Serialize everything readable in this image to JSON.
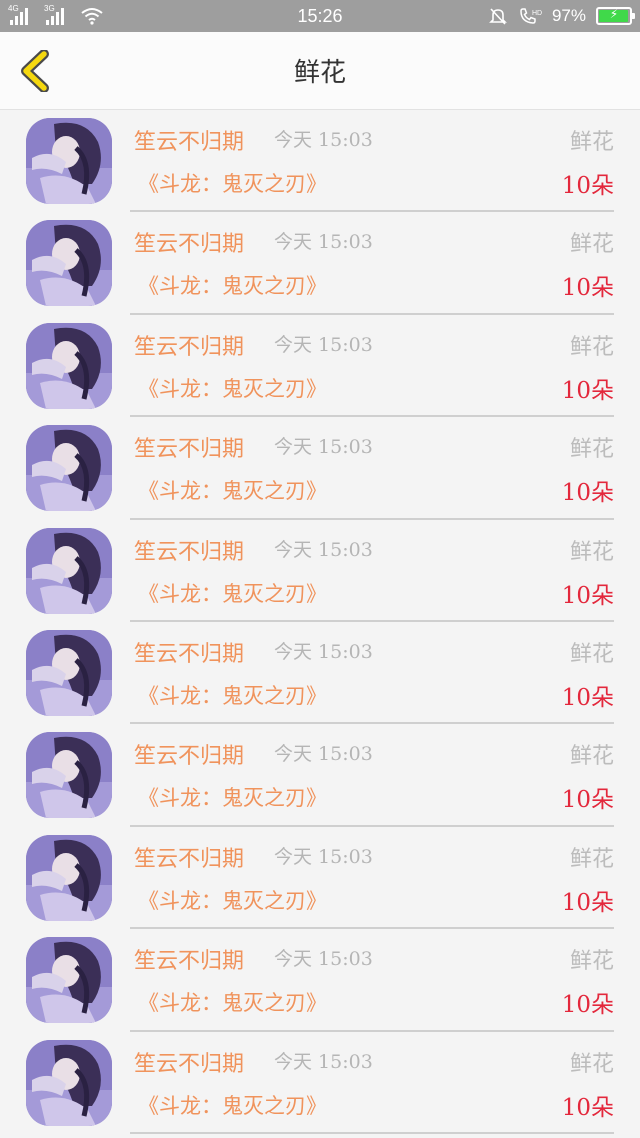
{
  "status_bar": {
    "net_label_1": "4G",
    "net_label_2": "3G",
    "time": "15:26",
    "battery_text": "97%",
    "battery_level": 0.97,
    "icons": [
      "signal-icon",
      "signal-icon",
      "wifi-icon",
      "mute-bell-icon",
      "hd-call-icon",
      "battery-icon"
    ]
  },
  "header": {
    "title": "鲜花",
    "back_icon": "chevron-left-icon",
    "accent_color": "#f5d80f"
  },
  "colors": {
    "name": "#f0935c",
    "count": "#e3283c",
    "muted": "#b5b5b5"
  },
  "records": [
    {
      "name": "笙云不归期",
      "time": "今天 15:03",
      "gift": "鲜花",
      "book": "《斗龙：鬼灭之刃》",
      "count": "10朵"
    },
    {
      "name": "笙云不归期",
      "time": "今天 15:03",
      "gift": "鲜花",
      "book": "《斗龙：鬼灭之刃》",
      "count": "10朵"
    },
    {
      "name": "笙云不归期",
      "time": "今天 15:03",
      "gift": "鲜花",
      "book": "《斗龙：鬼灭之刃》",
      "count": "10朵"
    },
    {
      "name": "笙云不归期",
      "time": "今天 15:03",
      "gift": "鲜花",
      "book": "《斗龙：鬼灭之刃》",
      "count": "10朵"
    },
    {
      "name": "笙云不归期",
      "time": "今天 15:03",
      "gift": "鲜花",
      "book": "《斗龙：鬼灭之刃》",
      "count": "10朵"
    },
    {
      "name": "笙云不归期",
      "time": "今天 15:03",
      "gift": "鲜花",
      "book": "《斗龙：鬼灭之刃》",
      "count": "10朵"
    },
    {
      "name": "笙云不归期",
      "time": "今天 15:03",
      "gift": "鲜花",
      "book": "《斗龙：鬼灭之刃》",
      "count": "10朵"
    },
    {
      "name": "笙云不归期",
      "time": "今天 15:03",
      "gift": "鲜花",
      "book": "《斗龙：鬼灭之刃》",
      "count": "10朵"
    },
    {
      "name": "笙云不归期",
      "time": "今天 15:03",
      "gift": "鲜花",
      "book": "《斗龙：鬼灭之刃》",
      "count": "10朵"
    },
    {
      "name": "笙云不归期",
      "time": "今天 15:03",
      "gift": "鲜花",
      "book": "《斗龙：鬼灭之刃》",
      "count": "10朵"
    }
  ]
}
